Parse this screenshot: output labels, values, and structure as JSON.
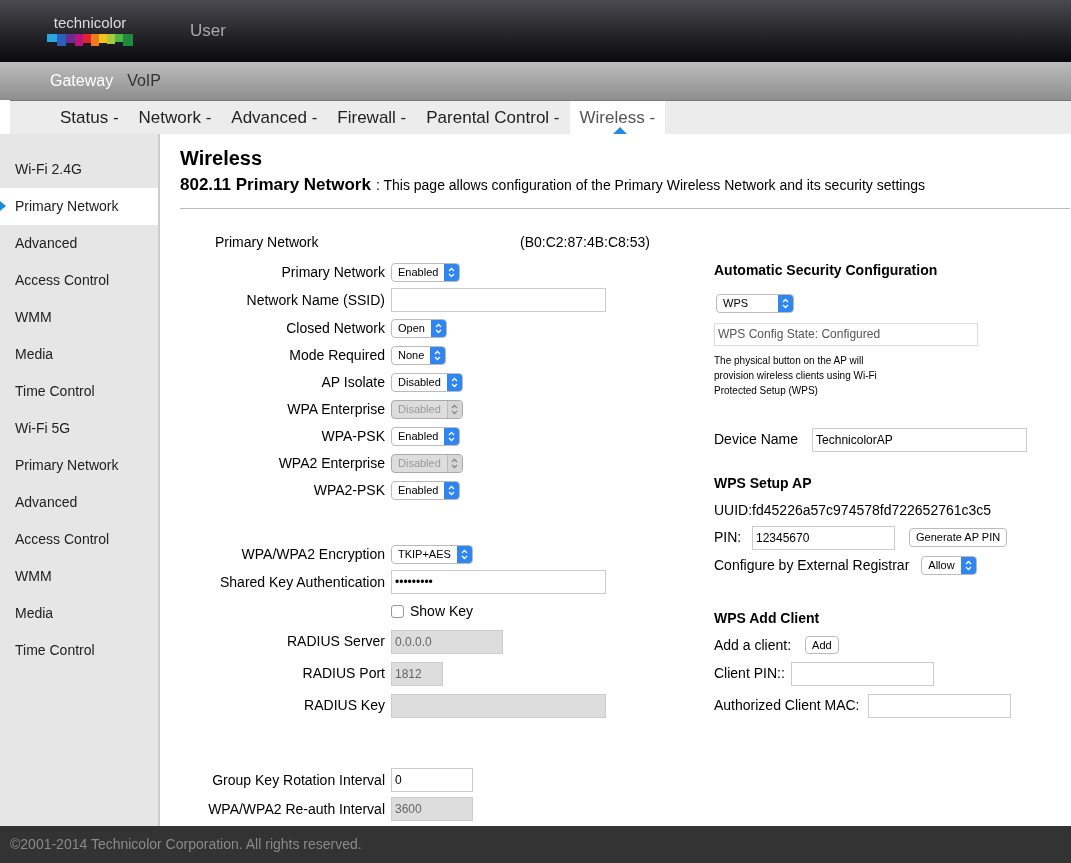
{
  "header": {
    "logo_text": "technicolor",
    "user": "User"
  },
  "top_nav": [
    {
      "label": "Gateway",
      "selected": true
    },
    {
      "label": "VoIP",
      "selected": false
    }
  ],
  "menu": [
    {
      "label": "Status -",
      "selected": false
    },
    {
      "label": "Network -",
      "selected": false
    },
    {
      "label": "Advanced -",
      "selected": false
    },
    {
      "label": "Firewall -",
      "selected": false
    },
    {
      "label": "Parental Control -",
      "selected": false
    },
    {
      "label": "Wireless -",
      "selected": true
    }
  ],
  "sidebar": {
    "items": [
      {
        "label": "Wi-Fi 2.4G",
        "selected": false
      },
      {
        "label": "Primary Network",
        "selected": true
      },
      {
        "label": "Advanced",
        "selected": false
      },
      {
        "label": "Access Control",
        "selected": false
      },
      {
        "label": "WMM",
        "selected": false
      },
      {
        "label": "Media",
        "selected": false
      },
      {
        "label": "Time Control",
        "selected": false
      },
      {
        "label": "Wi-Fi 5G",
        "selected": false
      },
      {
        "label": "Primary Network",
        "selected": false
      },
      {
        "label": "Advanced",
        "selected": false
      },
      {
        "label": "Access Control",
        "selected": false
      },
      {
        "label": "WMM",
        "selected": false
      },
      {
        "label": "Media",
        "selected": false
      },
      {
        "label": "Time Control",
        "selected": false
      }
    ]
  },
  "page": {
    "title": "Wireless",
    "subtitle": "802.11 Primary Network",
    "description": ": This page allows configuration of the Primary Wireless Network and its security settings"
  },
  "form": {
    "heading": "Primary Network",
    "mac": "(B0:C2:87:4B:C8:53)",
    "sections": [
      [
        {
          "kind": "select",
          "label": "Primary Network",
          "value": "Enabled",
          "disabled": false
        },
        {
          "kind": "text",
          "label": "Network Name (SSID)",
          "disabled": false
        },
        {
          "kind": "select",
          "label": "Closed Network",
          "value": "Open",
          "disabled": false
        },
        {
          "kind": "select",
          "label": "Mode Required",
          "value": "None",
          "disabled": false
        },
        {
          "kind": "select",
          "label": "AP Isolate",
          "value": "Disabled",
          "disabled": false
        },
        {
          "kind": "select",
          "label": "WPA Enterprise",
          "value": "Disabled",
          "disabled": true
        },
        {
          "kind": "select",
          "label": "WPA-PSK",
          "value": "Enabled",
          "disabled": false
        },
        {
          "kind": "select",
          "label": "WPA2 Enterprise",
          "value": "Disabled",
          "disabled": true
        },
        {
          "kind": "select",
          "label": "WPA2-PSK",
          "value": "Enabled",
          "disabled": false
        }
      ],
      [
        {
          "kind": "select",
          "label": "WPA/WPA2 Encryption",
          "value": "TKIP+AES",
          "disabled": false
        },
        {
          "kind": "password",
          "label": "Shared Key Authentication",
          "value": "•••••••••",
          "disabled": false
        },
        {
          "kind": "checkbox",
          "label": "Show Key",
          "checked": false
        },
        {
          "kind": "text",
          "label": "RADIUS Server",
          "value": "0.0.0.0",
          "disabled": true
        },
        {
          "kind": "text",
          "label": "RADIUS Port",
          "value": "1812",
          "disabled": true
        },
        {
          "kind": "text",
          "label": "RADIUS Key",
          "disabled": true
        }
      ],
      [
        {
          "kind": "text",
          "label": "Group Key Rotation Interval",
          "value": "0",
          "disabled": false
        },
        {
          "kind": "text",
          "label": "WPA/WPA2 Re-auth Interval",
          "value": "3600",
          "disabled": true
        }
      ]
    ]
  },
  "wps": {
    "heading": "Automatic Security Configuration",
    "mode": "WPS",
    "config_state": "WPS Config State: Configured",
    "note": "The physical button on the AP will provision wireless clients using Wi-Fi Protected Setup (WPS)",
    "device_name_label": "Device Name",
    "device_name": "TechnicolorAP",
    "setup_heading": "WPS Setup AP",
    "uuid": "UUID:fd45226a57c974578fd722652761c3c5",
    "pin_label": "PIN:",
    "pin": "12345670",
    "generate_button": "Generate AP PIN",
    "registrar_label": "Configure by External Registrar",
    "registrar": "Allow",
    "add_heading": "WPS Add Client",
    "add_label": "Add a client:",
    "add_button": "Add",
    "client_pin_label": "Client PIN::",
    "mac_label": "Authorized Client MAC:"
  },
  "footer": "©2001-2014 Technicolor Corporation. All rights reserved."
}
